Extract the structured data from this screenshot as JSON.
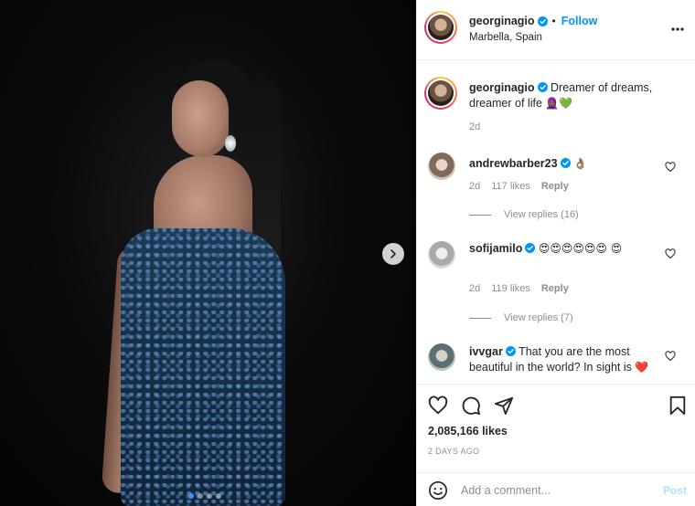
{
  "post": {
    "author": "georginagio",
    "follow_label": "Follow",
    "separator": "•",
    "location": "Marbella, Spain",
    "caption_text": "Dreamer of dreams, dreamer of life",
    "caption_emoji": "🧕🏾",
    "caption_heart": "💚",
    "caption_age": "2d",
    "likes": "2,085,166 likes",
    "date": "2 DAYS AGO"
  },
  "comments": [
    {
      "user": "andrewbarber23",
      "text": "",
      "emoji": "👌🏽",
      "age": "2d",
      "likes": "117 likes",
      "reply": "Reply",
      "view_replies": "View replies (16)"
    },
    {
      "user": "sofijamilo",
      "text": "",
      "emoji": "😍😍😍😍😍😍 😍",
      "age": "2d",
      "likes": "119 likes",
      "reply": "Reply",
      "view_replies": "View replies (7)"
    },
    {
      "user": "ivvgar",
      "text": "That you are the most beautiful in the world? In sight is",
      "emoji": "❤️"
    }
  ],
  "composer": {
    "placeholder": "Add a comment...",
    "post_label": "Post"
  },
  "carousel": {
    "count": 4,
    "active": 0
  },
  "icons": [
    "verified-icon",
    "more-options-icon",
    "heart-icon",
    "comment-icon",
    "share-icon",
    "bookmark-icon",
    "emoji-icon",
    "chevron-right-icon"
  ],
  "colors": {
    "accent": "#0095f6",
    "post_disabled": "#b2dffc",
    "muted": "#8e8e8e"
  }
}
